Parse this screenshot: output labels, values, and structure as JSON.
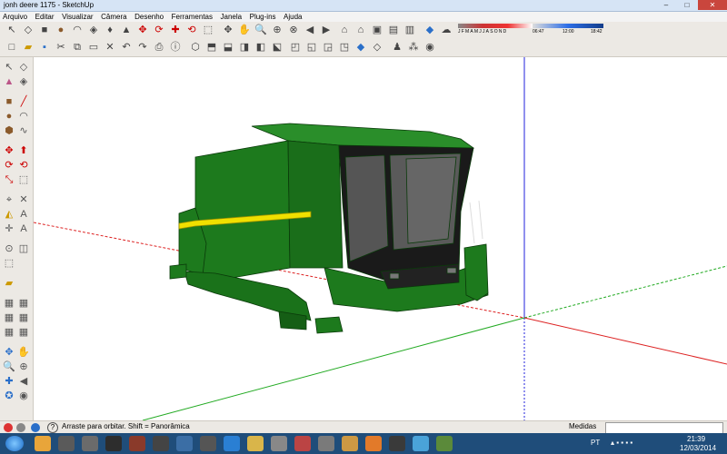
{
  "window": {
    "title": "jonh deere 1175 - SketchUp",
    "min": "–",
    "max": "□",
    "close": "✕"
  },
  "menu": [
    {
      "label": "Arquivo"
    },
    {
      "label": "Editar"
    },
    {
      "label": "Visualizar"
    },
    {
      "label": "Câmera"
    },
    {
      "label": "Desenho"
    },
    {
      "label": "Ferramentas"
    },
    {
      "label": "Janela"
    },
    {
      "label": "Plug-ins"
    },
    {
      "label": "Ajuda"
    }
  ],
  "shadow_panel": {
    "months": [
      "J",
      "F",
      "M",
      "A",
      "M",
      "J",
      "J",
      "A",
      "S",
      "O",
      "N",
      "D"
    ],
    "time_start": "06:47",
    "time_mid": "12:00",
    "time_end": "18:42"
  },
  "status": {
    "hint": "Arraste para orbitar. Shift = Panorâmica",
    "measure_label": "Medidas"
  },
  "taskbar": {
    "lang": "PT",
    "time": "21:39",
    "date": "12/03/2014"
  },
  "colors": {
    "model_green": "#1d7a1d",
    "model_dark_green": "#155e15",
    "stripe": "#f0e000",
    "axis_red": "#d22",
    "axis_green": "#2a2",
    "axis_blue": "#22d"
  }
}
